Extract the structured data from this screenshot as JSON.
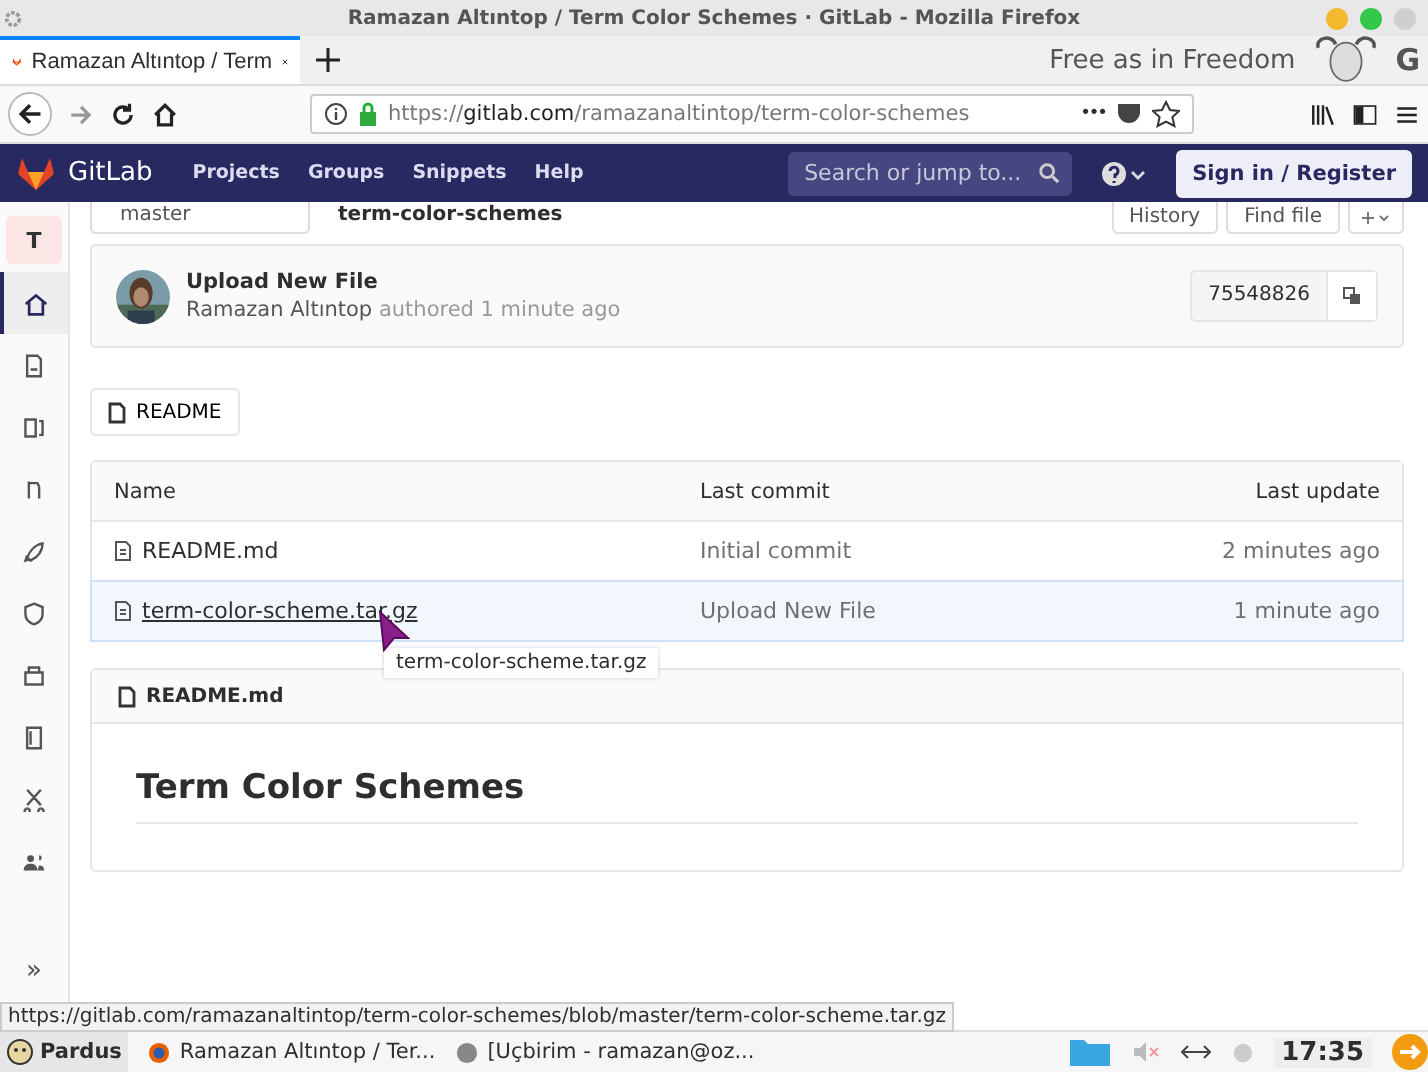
{
  "window": {
    "title": "Ramazan Altıntop / Term Color Schemes · GitLab - Mozilla Firefox"
  },
  "tabs": [
    {
      "label": "Ramazan Altıntop / Term",
      "selected": true
    }
  ],
  "theme_text": {
    "slogan": "Free as in Freedom",
    "letter": "G"
  },
  "address_bar": {
    "prefix": "https://",
    "host": "gitlab.com",
    "path": "/ramazanaltintop/term-color-schemes",
    "more": "•••"
  },
  "gitlab_nav": {
    "brand": "GitLab",
    "links": [
      "Projects",
      "Groups",
      "Snippets",
      "Help"
    ],
    "search": {
      "placeholder": "Search or jump to..."
    },
    "sign_in": "Sign in / Register"
  },
  "sidebar": {
    "project_letter": "T",
    "items": [
      {
        "selected": true
      },
      {
        "selected": false
      },
      {
        "selected": false
      },
      {
        "selected": false
      },
      {
        "selected": false
      },
      {
        "selected": false
      },
      {
        "selected": false
      },
      {
        "selected": false
      },
      {
        "selected": false
      },
      {
        "selected": false
      }
    ],
    "collapse": "»"
  },
  "top_row": {
    "branch": "master",
    "path": "term-color-schemes",
    "history": "History",
    "find": "Find file"
  },
  "commit": {
    "title": "Upload New File",
    "author": "Ramazan Altıntop",
    "meta": "authored 1 minute ago",
    "sha": "75548826"
  },
  "readme_button": "README",
  "table": {
    "columns": [
      "Name",
      "Last commit",
      "Last update"
    ],
    "rows": [
      {
        "name": "README.md",
        "commit": "Initial commit",
        "updated": "2 minutes ago",
        "hovered": false
      },
      {
        "name": "term-color-scheme.tar.gz",
        "commit": "Upload New File",
        "updated": "1 minute ago",
        "hovered": true
      }
    ]
  },
  "tooltip": "term-color-scheme.tar.gz",
  "readme": {
    "file": "README.md",
    "heading": "Term Color Schemes"
  },
  "status_url": "https://gitlab.com/ramazanaltintop/term-color-schemes/blob/master/term-color-scheme.tar.gz",
  "taskbar": {
    "start": "Pardus",
    "tasks": [
      "Ramazan Altıntop / Ter...",
      "[Uçbirim - ramazan@oz..."
    ],
    "clock": "17:35"
  }
}
